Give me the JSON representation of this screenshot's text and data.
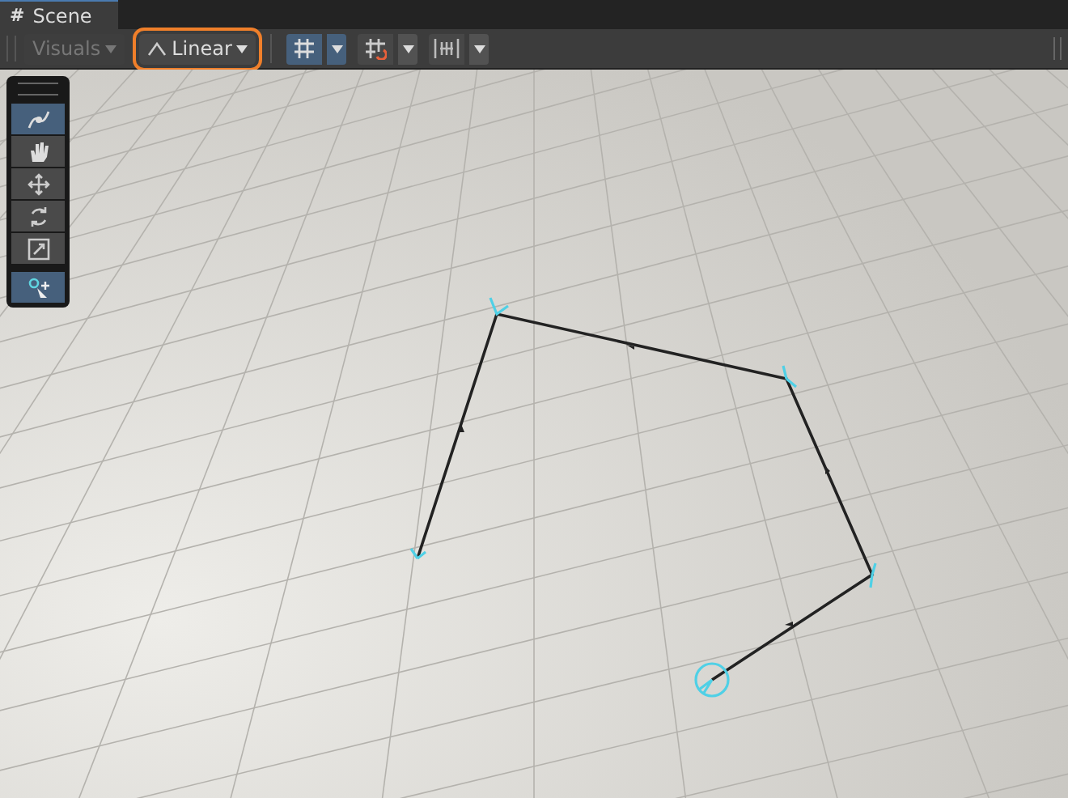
{
  "tab": {
    "title": "Scene",
    "icon": "#"
  },
  "toolbar": {
    "visuals": {
      "label": "Visuals",
      "disabled": true
    },
    "mode": {
      "label": "Linear",
      "highlighted": true
    },
    "toggles": [
      {
        "kind": "grid-snap",
        "selected": true
      },
      {
        "kind": "snap-increment",
        "selected": false
      },
      {
        "kind": "align",
        "selected": false
      }
    ]
  },
  "tools": [
    {
      "kind": "spline",
      "selected": true
    },
    {
      "kind": "hand",
      "selected": false
    },
    {
      "kind": "move",
      "selected": false
    },
    {
      "kind": "rotate",
      "selected": false
    },
    {
      "kind": "scale",
      "selected": false
    },
    {
      "kind": "add-knot",
      "selected": true
    }
  ]
}
